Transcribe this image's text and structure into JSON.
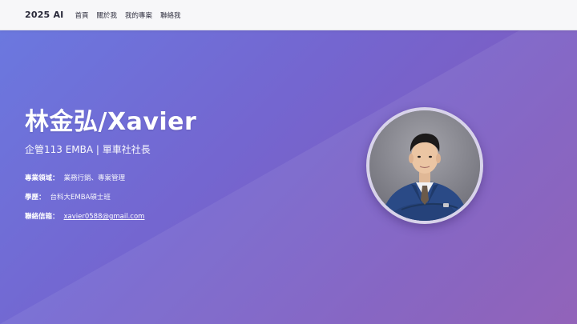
{
  "navbar": {
    "brand": "2025 AI",
    "links": [
      "首頁",
      "關於我",
      "我的專案",
      "聯絡我"
    ]
  },
  "hero": {
    "name": "林金弘/Xavier",
    "subtitle": "企管113 EMBA | 單車社社長",
    "expertise_label": "專業領域：",
    "expertise_value": "業務行銷、專案管理",
    "education_label": "學歷：",
    "education_value": "台科大EMBA碩士班",
    "email_label": "聯絡信箱：",
    "email_value": "xavier0588@gmail.com"
  },
  "colors": {
    "gradient_start": "#6b78df",
    "gradient_end": "#8a58b4",
    "navbar_bg": "#f7f7f9",
    "text": "#ffffff"
  }
}
